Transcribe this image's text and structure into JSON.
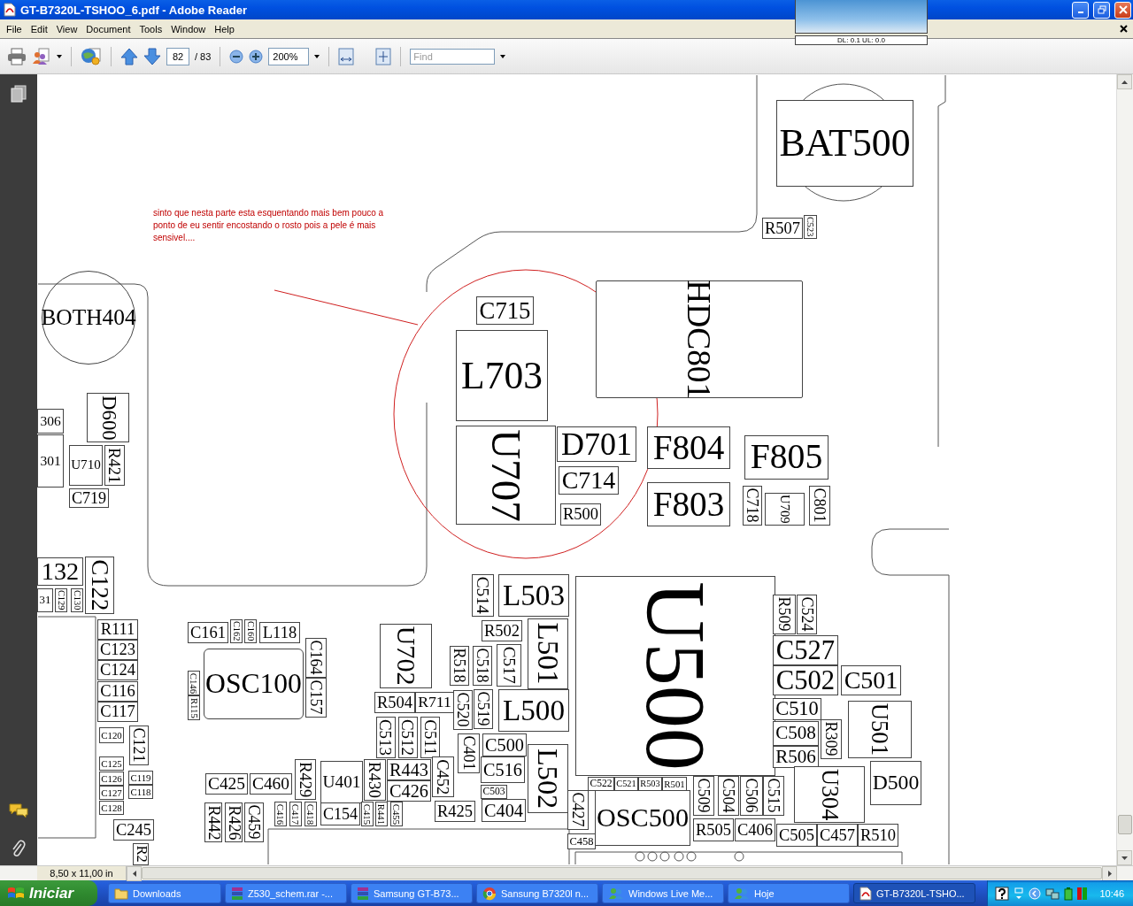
{
  "window": {
    "title": "GT-B7320L-TSHOO_6.pdf - Adobe Reader"
  },
  "menu": [
    "File",
    "Edit",
    "View",
    "Document",
    "Tools",
    "Window",
    "Help"
  ],
  "toolbar": {
    "page": "82",
    "page_total": "/ 83",
    "zoom": "200%",
    "find": {
      "placeholder": "Find"
    }
  },
  "overlay": {
    "reading": "DL: 0.1 UL: 0.0"
  },
  "document": {
    "note": "sinto que nesta parte esta esquentando mais bem pouco a ponto de eu sentir encostando o rosto pois a pele é mais sensivel....",
    "components": [
      {
        "label": "BAT500",
        "rotated": false,
        "kind": "rect"
      },
      {
        "label": "R507",
        "rotated": false,
        "kind": "rect"
      },
      {
        "label": "C523",
        "rotated": true,
        "kind": "rect"
      },
      {
        "label": "BOTH404",
        "rotated": false,
        "kind": "circle"
      },
      {
        "label": "C715",
        "rotated": false,
        "kind": "rect"
      },
      {
        "label": "L703",
        "rotated": false,
        "kind": "rect"
      },
      {
        "label": "HDC801",
        "rotated": true,
        "kind": "connector"
      },
      {
        "label": "U707",
        "rotated": true,
        "kind": "rect"
      },
      {
        "label": "D701",
        "rotated": false,
        "kind": "rect"
      },
      {
        "label": "C714",
        "rotated": false,
        "kind": "rect"
      },
      {
        "label": "R500",
        "rotated": false,
        "kind": "rect"
      },
      {
        "label": "F804",
        "rotated": false,
        "kind": "rect"
      },
      {
        "label": "F805",
        "rotated": false,
        "kind": "rect"
      },
      {
        "label": "F803",
        "rotated": false,
        "kind": "rect"
      },
      {
        "label": "C718",
        "rotated": true,
        "kind": "rect"
      },
      {
        "label": "U709",
        "rotated": true,
        "kind": "rect"
      },
      {
        "label": "C801",
        "rotated": true,
        "kind": "rect"
      },
      {
        "label": "306",
        "rotated": false,
        "kind": "rect"
      },
      {
        "label": "D600",
        "rotated": true,
        "kind": "rect"
      },
      {
        "label": "301",
        "rotated": false,
        "kind": "rect"
      },
      {
        "label": "U710",
        "rotated": false,
        "kind": "rect"
      },
      {
        "label": "R421",
        "rotated": true,
        "kind": "rect"
      },
      {
        "label": "C719",
        "rotated": false,
        "kind": "rect"
      },
      {
        "label": "132",
        "rotated": false,
        "kind": "rect"
      },
      {
        "label": "31",
        "rotated": false,
        "kind": "rect"
      },
      {
        "label": "C129",
        "rotated": true,
        "kind": "rect"
      },
      {
        "label": "C130",
        "rotated": true,
        "kind": "rect"
      },
      {
        "label": "C122",
        "rotated": true,
        "kind": "rect"
      },
      {
        "label": "R111",
        "rotated": false,
        "kind": "rect"
      },
      {
        "label": "C123",
        "rotated": false,
        "kind": "rect"
      },
      {
        "label": "C124",
        "rotated": false,
        "kind": "rect"
      },
      {
        "label": "C116",
        "rotated": false,
        "kind": "rect"
      },
      {
        "label": "C117",
        "rotated": false,
        "kind": "rect"
      },
      {
        "label": "C120",
        "rotated": false,
        "kind": "rect"
      },
      {
        "label": "C121",
        "rotated": true,
        "kind": "rect"
      },
      {
        "label": "C125",
        "rotated": false,
        "kind": "rect"
      },
      {
        "label": "C126",
        "rotated": false,
        "kind": "rect"
      },
      {
        "label": "C119",
        "rotated": false,
        "kind": "rect"
      },
      {
        "label": "C127",
        "rotated": false,
        "kind": "rect"
      },
      {
        "label": "C118",
        "rotated": false,
        "kind": "rect"
      },
      {
        "label": "C128",
        "rotated": false,
        "kind": "rect"
      },
      {
        "label": "C245",
        "rotated": false,
        "kind": "rect"
      },
      {
        "label": "R2",
        "rotated": true,
        "kind": "rect"
      },
      {
        "label": "C161",
        "rotated": false,
        "kind": "rect"
      },
      {
        "label": "C162",
        "rotated": true,
        "kind": "rect"
      },
      {
        "label": "C160",
        "rotated": true,
        "kind": "rect"
      },
      {
        "label": "L118",
        "rotated": false,
        "kind": "rect"
      },
      {
        "label": "OSC100",
        "rotated": false,
        "kind": "osc"
      },
      {
        "label": "C164",
        "rotated": true,
        "kind": "rect"
      },
      {
        "label": "C157",
        "rotated": true,
        "kind": "rect"
      },
      {
        "label": "C146",
        "rotated": true,
        "kind": "rect"
      },
      {
        "label": "R115",
        "rotated": true,
        "kind": "rect"
      },
      {
        "label": "U702",
        "rotated": true,
        "kind": "rect"
      },
      {
        "label": "R504",
        "rotated": false,
        "kind": "rect"
      },
      {
        "label": "R711",
        "rotated": false,
        "kind": "rect"
      },
      {
        "label": "C513",
        "rotated": true,
        "kind": "rect"
      },
      {
        "label": "C512",
        "rotated": true,
        "kind": "rect"
      },
      {
        "label": "C511",
        "rotated": true,
        "kind": "rect"
      },
      {
        "label": "R429",
        "rotated": true,
        "kind": "rect"
      },
      {
        "label": "U401",
        "rotated": false,
        "kind": "rect"
      },
      {
        "label": "R430",
        "rotated": true,
        "kind": "rect"
      },
      {
        "label": "R443",
        "rotated": false,
        "kind": "rect"
      },
      {
        "label": "C426",
        "rotated": false,
        "kind": "rect"
      },
      {
        "label": "C452",
        "rotated": true,
        "kind": "rect"
      },
      {
        "label": "C425",
        "rotated": false,
        "kind": "rect"
      },
      {
        "label": "C460",
        "rotated": false,
        "kind": "rect"
      },
      {
        "label": "R442",
        "rotated": true,
        "kind": "rect"
      },
      {
        "label": "R426",
        "rotated": true,
        "kind": "rect"
      },
      {
        "label": "C459",
        "rotated": true,
        "kind": "rect"
      },
      {
        "label": "C416",
        "rotated": true,
        "kind": "rect"
      },
      {
        "label": "C417",
        "rotated": true,
        "kind": "rect"
      },
      {
        "label": "C418",
        "rotated": true,
        "kind": "rect"
      },
      {
        "label": "C154",
        "rotated": false,
        "kind": "rect"
      },
      {
        "label": "C415",
        "rotated": true,
        "kind": "rect"
      },
      {
        "label": "R441",
        "rotated": true,
        "kind": "rect"
      },
      {
        "label": "C455",
        "rotated": true,
        "kind": "rect"
      },
      {
        "label": "R425",
        "rotated": false,
        "kind": "rect"
      },
      {
        "label": "C514",
        "rotated": true,
        "kind": "rect"
      },
      {
        "label": "L503",
        "rotated": false,
        "kind": "rect"
      },
      {
        "label": "R502",
        "rotated": false,
        "kind": "rect"
      },
      {
        "label": "L501",
        "rotated": true,
        "kind": "rect"
      },
      {
        "label": "R518",
        "rotated": true,
        "kind": "rect"
      },
      {
        "label": "C518",
        "rotated": true,
        "kind": "rect"
      },
      {
        "label": "C517",
        "rotated": true,
        "kind": "rect"
      },
      {
        "label": "C520",
        "rotated": true,
        "kind": "rect"
      },
      {
        "label": "C519",
        "rotated": true,
        "kind": "rect"
      },
      {
        "label": "L500",
        "rotated": false,
        "kind": "rect"
      },
      {
        "label": "C401",
        "rotated": true,
        "kind": "rect"
      },
      {
        "label": "C500",
        "rotated": false,
        "kind": "rect"
      },
      {
        "label": "C516",
        "rotated": false,
        "kind": "rect"
      },
      {
        "label": "C503",
        "rotated": false,
        "kind": "rect"
      },
      {
        "label": "L502",
        "rotated": true,
        "kind": "rect"
      },
      {
        "label": "C404",
        "rotated": false,
        "kind": "rect"
      },
      {
        "label": "U500",
        "rotated": true,
        "kind": "rect"
      },
      {
        "label": "C522",
        "rotated": false,
        "kind": "rect"
      },
      {
        "label": "C521",
        "rotated": false,
        "kind": "rect"
      },
      {
        "label": "R503",
        "rotated": false,
        "kind": "rect"
      },
      {
        "label": "R501",
        "rotated": false,
        "kind": "rect"
      },
      {
        "label": "OSC500",
        "rotated": false,
        "kind": "rect"
      },
      {
        "label": "C427",
        "rotated": true,
        "kind": "rect"
      },
      {
        "label": "C458",
        "rotated": false,
        "kind": "rect"
      },
      {
        "label": "C509",
        "rotated": true,
        "kind": "rect"
      },
      {
        "label": "C504",
        "rotated": true,
        "kind": "rect"
      },
      {
        "label": "C506",
        "rotated": true,
        "kind": "rect"
      },
      {
        "label": "C515",
        "rotated": true,
        "kind": "rect"
      },
      {
        "label": "R505",
        "rotated": false,
        "kind": "rect"
      },
      {
        "label": "C406",
        "rotated": false,
        "kind": "rect"
      },
      {
        "label": "C505",
        "rotated": false,
        "kind": "rect"
      },
      {
        "label": "C457",
        "rotated": false,
        "kind": "rect"
      },
      {
        "label": "R510",
        "rotated": false,
        "kind": "rect"
      },
      {
        "label": "R509",
        "rotated": true,
        "kind": "rect"
      },
      {
        "label": "C524",
        "rotated": true,
        "kind": "rect"
      },
      {
        "label": "C527",
        "rotated": false,
        "kind": "rect"
      },
      {
        "label": "C502",
        "rotated": false,
        "kind": "rect"
      },
      {
        "label": "C501",
        "rotated": false,
        "kind": "rect"
      },
      {
        "label": "C510",
        "rotated": false,
        "kind": "rect"
      },
      {
        "label": "C508",
        "rotated": false,
        "kind": "rect"
      },
      {
        "label": "R309",
        "rotated": true,
        "kind": "rect"
      },
      {
        "label": "R506",
        "rotated": false,
        "kind": "rect"
      },
      {
        "label": "U501",
        "rotated": true,
        "kind": "rect"
      },
      {
        "label": "U304",
        "rotated": true,
        "kind": "rect"
      },
      {
        "label": "D500",
        "rotated": false,
        "kind": "rect"
      }
    ]
  },
  "status": {
    "page_size": "8,50 x 11,00 in"
  },
  "taskbar": {
    "start": "Iniciar",
    "items": [
      {
        "label": "Downloads",
        "kind": "folder",
        "selected": false
      },
      {
        "label": "Z530_schem.rar -...",
        "kind": "archive",
        "selected": false
      },
      {
        "label": "Samsung GT-B73...",
        "kind": "archive",
        "selected": false
      },
      {
        "label": "Sansung B7320l n...",
        "kind": "browser",
        "selected": false
      },
      {
        "label": "Windows Live Me...",
        "kind": "messenger",
        "selected": false
      },
      {
        "label": "Hoje",
        "kind": "messenger",
        "selected": false
      },
      {
        "label": "GT-B7320L-TSHO...",
        "kind": "document",
        "selected": true
      }
    ],
    "clock": "10:46"
  }
}
